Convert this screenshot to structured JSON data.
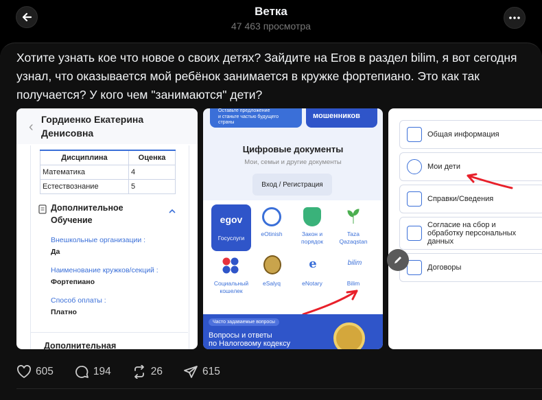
{
  "header": {
    "title": "Ветка",
    "views": "47 463 просмотра"
  },
  "post": {
    "text": "Хотите узнать кое что новое о своих детях? Зайдите на Егов в раздел bilim, я вот сегодня узнал, что оказывается мой ребёнок занимается в кружке фортепиано. Это как так получается? У кого чем \"занимаются\" дети?"
  },
  "image1": {
    "name_line1": "Гордиенко Екатерина",
    "name_line2": "Денисовна",
    "table_headers": [
      "Дисциплина",
      "Оценка"
    ],
    "rows": [
      [
        "Математика",
        "4"
      ],
      [
        "Естествознание",
        "5"
      ]
    ],
    "section_line1": "Дополнительное",
    "section_line2": "Обучение",
    "label1": "Внешкольные организации :",
    "value1": "Да",
    "label2": "Наименование кружков/секций :",
    "value2": "Фортепиано",
    "label3": "Способ оплаты :",
    "value3": "Платно",
    "section2": "Дополнительная"
  },
  "image2": {
    "top_left_line1": "Оставьте предложение",
    "top_left_line2": "и станьте частью будущего",
    "top_left_line3": "страны",
    "top_right": "мошенников",
    "title": "Цифровые документы",
    "subtitle": "Мои, семьи и другие документы",
    "login": "Вход / Регистрация",
    "apps": [
      "egov",
      "Госуслуги",
      "eOtinish",
      "Закон и порядок",
      "Taza Qazaqstan",
      "Социальный кошелек",
      "eSalyq",
      "eNotary",
      "Bilim"
    ],
    "banner_small": "Часто задаваемые вопросы",
    "banner_line1": "Вопросы и ответы",
    "banner_line2": "по Налоговому кодексу"
  },
  "image3": {
    "items": [
      "Общая информация",
      "Мои дети",
      "Справки/Сведения",
      "Согласие на сбор и обработку персональных данных",
      "Договоры"
    ]
  },
  "actions": {
    "likes": "605",
    "replies": "194",
    "reposts": "26",
    "shares": "615"
  },
  "colors": {
    "background": "#000000",
    "card": "#101010",
    "egov_blue": "#2f55c9",
    "arrow_red": "#e8202a"
  }
}
